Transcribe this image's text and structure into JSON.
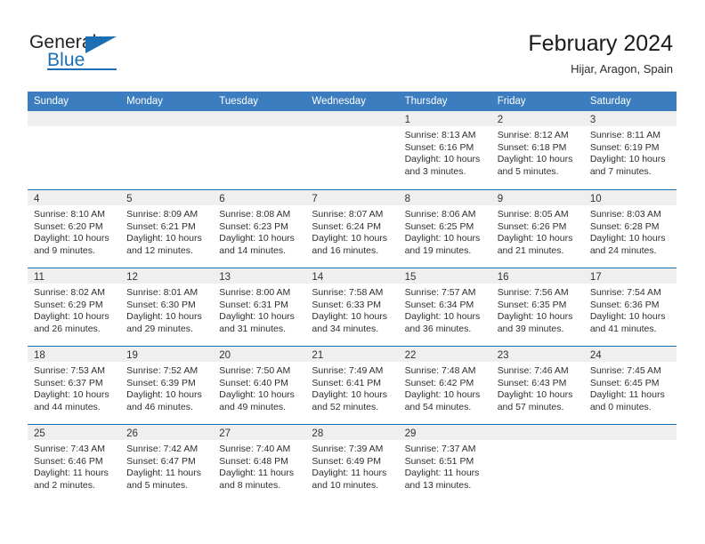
{
  "brand": {
    "name_top": "General",
    "name_bottom": "Blue",
    "accent_color": "#1c6fb5"
  },
  "header": {
    "title": "February 2024",
    "subtitle": "Hijar, Aragon, Spain"
  },
  "calendar": {
    "header_bg": "#3b7dbf",
    "band_bg": "#efefef",
    "row_border_color": "#1c6fb5",
    "weekdays": [
      "Sunday",
      "Monday",
      "Tuesday",
      "Wednesday",
      "Thursday",
      "Friday",
      "Saturday"
    ],
    "weeks": [
      [
        {
          "day": "",
          "sunrise": "",
          "sunset": "",
          "daylight_1": "",
          "daylight_2": ""
        },
        {
          "day": "",
          "sunrise": "",
          "sunset": "",
          "daylight_1": "",
          "daylight_2": ""
        },
        {
          "day": "",
          "sunrise": "",
          "sunset": "",
          "daylight_1": "",
          "daylight_2": ""
        },
        {
          "day": "",
          "sunrise": "",
          "sunset": "",
          "daylight_1": "",
          "daylight_2": ""
        },
        {
          "day": "1",
          "sunrise": "Sunrise: 8:13 AM",
          "sunset": "Sunset: 6:16 PM",
          "daylight_1": "Daylight: 10 hours",
          "daylight_2": "and 3 minutes."
        },
        {
          "day": "2",
          "sunrise": "Sunrise: 8:12 AM",
          "sunset": "Sunset: 6:18 PM",
          "daylight_1": "Daylight: 10 hours",
          "daylight_2": "and 5 minutes."
        },
        {
          "day": "3",
          "sunrise": "Sunrise: 8:11 AM",
          "sunset": "Sunset: 6:19 PM",
          "daylight_1": "Daylight: 10 hours",
          "daylight_2": "and 7 minutes."
        }
      ],
      [
        {
          "day": "4",
          "sunrise": "Sunrise: 8:10 AM",
          "sunset": "Sunset: 6:20 PM",
          "daylight_1": "Daylight: 10 hours",
          "daylight_2": "and 9 minutes."
        },
        {
          "day": "5",
          "sunrise": "Sunrise: 8:09 AM",
          "sunset": "Sunset: 6:21 PM",
          "daylight_1": "Daylight: 10 hours",
          "daylight_2": "and 12 minutes."
        },
        {
          "day": "6",
          "sunrise": "Sunrise: 8:08 AM",
          "sunset": "Sunset: 6:23 PM",
          "daylight_1": "Daylight: 10 hours",
          "daylight_2": "and 14 minutes."
        },
        {
          "day": "7",
          "sunrise": "Sunrise: 8:07 AM",
          "sunset": "Sunset: 6:24 PM",
          "daylight_1": "Daylight: 10 hours",
          "daylight_2": "and 16 minutes."
        },
        {
          "day": "8",
          "sunrise": "Sunrise: 8:06 AM",
          "sunset": "Sunset: 6:25 PM",
          "daylight_1": "Daylight: 10 hours",
          "daylight_2": "and 19 minutes."
        },
        {
          "day": "9",
          "sunrise": "Sunrise: 8:05 AM",
          "sunset": "Sunset: 6:26 PM",
          "daylight_1": "Daylight: 10 hours",
          "daylight_2": "and 21 minutes."
        },
        {
          "day": "10",
          "sunrise": "Sunrise: 8:03 AM",
          "sunset": "Sunset: 6:28 PM",
          "daylight_1": "Daylight: 10 hours",
          "daylight_2": "and 24 minutes."
        }
      ],
      [
        {
          "day": "11",
          "sunrise": "Sunrise: 8:02 AM",
          "sunset": "Sunset: 6:29 PM",
          "daylight_1": "Daylight: 10 hours",
          "daylight_2": "and 26 minutes."
        },
        {
          "day": "12",
          "sunrise": "Sunrise: 8:01 AM",
          "sunset": "Sunset: 6:30 PM",
          "daylight_1": "Daylight: 10 hours",
          "daylight_2": "and 29 minutes."
        },
        {
          "day": "13",
          "sunrise": "Sunrise: 8:00 AM",
          "sunset": "Sunset: 6:31 PM",
          "daylight_1": "Daylight: 10 hours",
          "daylight_2": "and 31 minutes."
        },
        {
          "day": "14",
          "sunrise": "Sunrise: 7:58 AM",
          "sunset": "Sunset: 6:33 PM",
          "daylight_1": "Daylight: 10 hours",
          "daylight_2": "and 34 minutes."
        },
        {
          "day": "15",
          "sunrise": "Sunrise: 7:57 AM",
          "sunset": "Sunset: 6:34 PM",
          "daylight_1": "Daylight: 10 hours",
          "daylight_2": "and 36 minutes."
        },
        {
          "day": "16",
          "sunrise": "Sunrise: 7:56 AM",
          "sunset": "Sunset: 6:35 PM",
          "daylight_1": "Daylight: 10 hours",
          "daylight_2": "and 39 minutes."
        },
        {
          "day": "17",
          "sunrise": "Sunrise: 7:54 AM",
          "sunset": "Sunset: 6:36 PM",
          "daylight_1": "Daylight: 10 hours",
          "daylight_2": "and 41 minutes."
        }
      ],
      [
        {
          "day": "18",
          "sunrise": "Sunrise: 7:53 AM",
          "sunset": "Sunset: 6:37 PM",
          "daylight_1": "Daylight: 10 hours",
          "daylight_2": "and 44 minutes."
        },
        {
          "day": "19",
          "sunrise": "Sunrise: 7:52 AM",
          "sunset": "Sunset: 6:39 PM",
          "daylight_1": "Daylight: 10 hours",
          "daylight_2": "and 46 minutes."
        },
        {
          "day": "20",
          "sunrise": "Sunrise: 7:50 AM",
          "sunset": "Sunset: 6:40 PM",
          "daylight_1": "Daylight: 10 hours",
          "daylight_2": "and 49 minutes."
        },
        {
          "day": "21",
          "sunrise": "Sunrise: 7:49 AM",
          "sunset": "Sunset: 6:41 PM",
          "daylight_1": "Daylight: 10 hours",
          "daylight_2": "and 52 minutes."
        },
        {
          "day": "22",
          "sunrise": "Sunrise: 7:48 AM",
          "sunset": "Sunset: 6:42 PM",
          "daylight_1": "Daylight: 10 hours",
          "daylight_2": "and 54 minutes."
        },
        {
          "day": "23",
          "sunrise": "Sunrise: 7:46 AM",
          "sunset": "Sunset: 6:43 PM",
          "daylight_1": "Daylight: 10 hours",
          "daylight_2": "and 57 minutes."
        },
        {
          "day": "24",
          "sunrise": "Sunrise: 7:45 AM",
          "sunset": "Sunset: 6:45 PM",
          "daylight_1": "Daylight: 11 hours",
          "daylight_2": "and 0 minutes."
        }
      ],
      [
        {
          "day": "25",
          "sunrise": "Sunrise: 7:43 AM",
          "sunset": "Sunset: 6:46 PM",
          "daylight_1": "Daylight: 11 hours",
          "daylight_2": "and 2 minutes."
        },
        {
          "day": "26",
          "sunrise": "Sunrise: 7:42 AM",
          "sunset": "Sunset: 6:47 PM",
          "daylight_1": "Daylight: 11 hours",
          "daylight_2": "and 5 minutes."
        },
        {
          "day": "27",
          "sunrise": "Sunrise: 7:40 AM",
          "sunset": "Sunset: 6:48 PM",
          "daylight_1": "Daylight: 11 hours",
          "daylight_2": "and 8 minutes."
        },
        {
          "day": "28",
          "sunrise": "Sunrise: 7:39 AM",
          "sunset": "Sunset: 6:49 PM",
          "daylight_1": "Daylight: 11 hours",
          "daylight_2": "and 10 minutes."
        },
        {
          "day": "29",
          "sunrise": "Sunrise: 7:37 AM",
          "sunset": "Sunset: 6:51 PM",
          "daylight_1": "Daylight: 11 hours",
          "daylight_2": "and 13 minutes."
        },
        {
          "day": "",
          "sunrise": "",
          "sunset": "",
          "daylight_1": "",
          "daylight_2": ""
        },
        {
          "day": "",
          "sunrise": "",
          "sunset": "",
          "daylight_1": "",
          "daylight_2": ""
        }
      ]
    ]
  }
}
